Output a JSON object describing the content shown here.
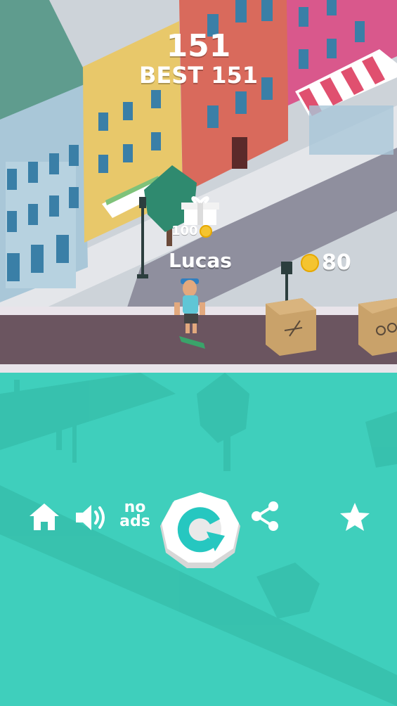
{
  "hud": {
    "score": "151",
    "best": "BEST  151"
  },
  "gift": {
    "reward": "100"
  },
  "player": {
    "name": "Lucas"
  },
  "wallet": {
    "coins": "80"
  },
  "menu": {
    "no_ads_line1": "no",
    "no_ads_line2": "ads"
  },
  "icons": [
    "home-icon",
    "sound-icon",
    "no-ads-icon",
    "replay-icon",
    "share-icon",
    "star-icon",
    "gift-icon",
    "coin-icon"
  ],
  "colors": {
    "water": "#3fcfbc",
    "road": "#6b5560",
    "building_red": "#d96a5c",
    "building_yellow": "#e8c86a",
    "building_blue": "#a9c7d8",
    "building_pink": "#d9588c"
  }
}
